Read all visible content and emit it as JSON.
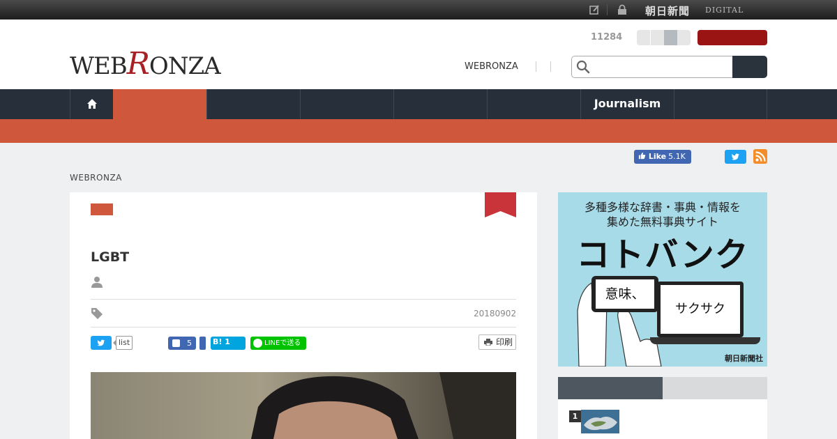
{
  "topbar": {
    "brand": "朝日新聞",
    "brand_suffix": "DIGITAL",
    "icons": [
      "edit-icon",
      "lock-icon"
    ]
  },
  "header": {
    "logo_left": "WEB",
    "logo_r": "R",
    "logo_right": "ONZA",
    "counter": "11284",
    "link": "WEBRONZA",
    "search_placeholder": ""
  },
  "nav": {
    "items": [
      "",
      "",
      "",
      "",
      "",
      "Journalism",
      ""
    ],
    "active_index": 0
  },
  "social": {
    "fb_like_label": "Like",
    "fb_like_count": "5.1K"
  },
  "breadcrumb": "WEBRONZA",
  "article": {
    "title": "LGBT",
    "date": "20180902",
    "share": {
      "twitter_list": "list",
      "facebook_count": "5",
      "hatena_label": "B!",
      "hatena_count": "1",
      "line_label": "LINEで送る"
    },
    "print_label": "印刷"
  },
  "ad": {
    "line1": "多種多様な辞書・事典・情報を",
    "line2": "集めた無料事典サイト",
    "headline": "コトバンク",
    "phone_text": "意味、",
    "laptop_text": "サクサク",
    "sponsor": "朝日新聞社"
  },
  "ranking": {
    "items": [
      {
        "rank": "1"
      }
    ]
  },
  "colors": {
    "accent": "#cf583c",
    "nav_bg": "#27303a",
    "logo_red": "#a81f24",
    "header_button": "#9b1414"
  }
}
